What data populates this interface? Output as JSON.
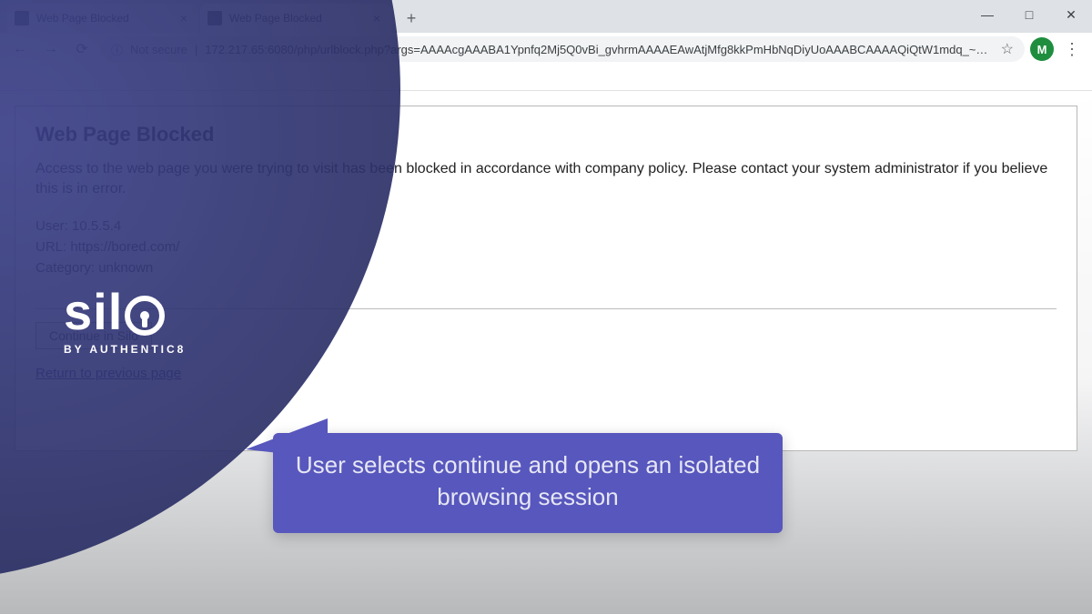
{
  "browser": {
    "tabs": [
      {
        "title": "Web Page Blocked",
        "active": false
      },
      {
        "title": "Web Page Blocked",
        "active": true
      }
    ],
    "window": {
      "minimize": "—",
      "maximize": "□",
      "close": "✕"
    },
    "newTab": "+",
    "tabClose": "×",
    "nav": {
      "back": "←",
      "forward": "→",
      "reload": "⟳"
    },
    "security_label": "Not secure",
    "url": "172.217.65:6080/php/urlblock.php?args=AAAAcgAAABA1Ypnfq2Mj5Q0vBi_gvhrmAAAAEAwAtjMfg8kkPmHbNqDiyUoAAABCAAAAQiQtW1mdq_~bRP...",
    "star": "☆",
    "avatar_initial": "M",
    "menu": "⋮"
  },
  "page": {
    "title": "Web Page Blocked",
    "message": "Access to the web page you were trying to visit has been blocked in accordance with company policy. Please contact your system administrator if you believe this is in error.",
    "user_line": "User: 10.5.5.4",
    "url_line": "URL: https://bored.com/",
    "category_line": "Category: unknown",
    "continue_btn": "Continue in Silo",
    "return_link": "Return to previous page"
  },
  "logo": {
    "word_prefix": "sil",
    "subline": "BY AUTHENTIC8"
  },
  "callout": {
    "text": "User selects continue and opens an isolated browsing session"
  }
}
